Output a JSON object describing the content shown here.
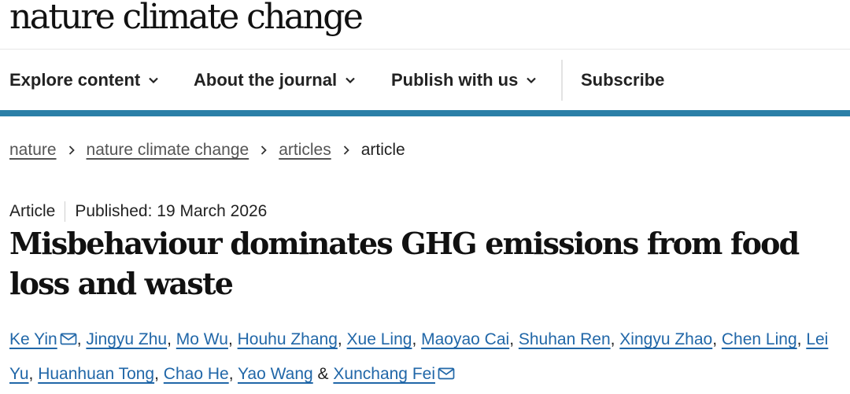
{
  "journal": {
    "name": "nature climate change"
  },
  "nav": {
    "items": [
      {
        "label": "Explore content",
        "has_dropdown": true
      },
      {
        "label": "About the journal",
        "has_dropdown": true
      },
      {
        "label": "Publish with us",
        "has_dropdown": true
      },
      {
        "label": "Subscribe",
        "has_dropdown": false
      }
    ],
    "accent_color": "#2b7fa7"
  },
  "breadcrumb": {
    "items": [
      "nature",
      "nature climate change",
      "articles"
    ],
    "current": "article"
  },
  "article": {
    "type": "Article",
    "published": "Published: 19 March 2026",
    "title": "Misbehaviour dominates GHG emissions from food loss and waste",
    "authors": [
      {
        "name": "Ke Yin",
        "email_icon": true
      },
      {
        "name": "Jingyu Zhu"
      },
      {
        "name": "Mo Wu"
      },
      {
        "name": "Houhu Zhang"
      },
      {
        "name": "Xue Ling"
      },
      {
        "name": "Maoyao Cai"
      },
      {
        "name": "Shuhan Ren"
      },
      {
        "name": "Xingyu Zhao"
      },
      {
        "name": "Chen Ling"
      },
      {
        "name": "Lei Yu"
      },
      {
        "name": "Huanhuan Tong"
      },
      {
        "name": "Chao He"
      },
      {
        "name": "Yao Wang"
      },
      {
        "name": "Xunchang Fei",
        "email_icon": true
      }
    ],
    "author_separator": ", ",
    "last_author_joiner": " & ",
    "link_color": "#2167a8",
    "icons": {
      "email": "envelope-icon",
      "dropdown": "chevron-down-icon",
      "breadcrumb_sep": "chevron-right-icon"
    }
  }
}
